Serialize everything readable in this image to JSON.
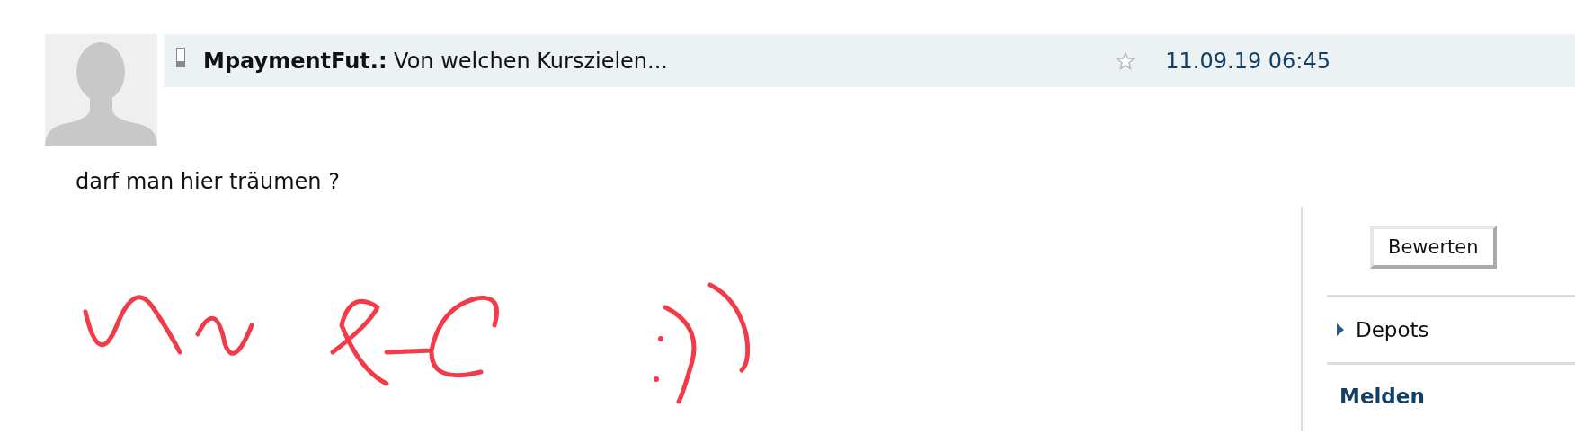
{
  "post": {
    "author": "MpaymentFut.:",
    "subject": "Von welchen Kurszielen...",
    "starred": false,
    "timestamp": "11.09.19 06:45",
    "body": "darf man hier träumen ?"
  },
  "sidebar": {
    "rate_button": "Bewerten",
    "menu": [
      {
        "label": "Depots",
        "kind": "expander",
        "expanded": false
      },
      {
        "label": "Melden",
        "kind": "link"
      }
    ]
  }
}
